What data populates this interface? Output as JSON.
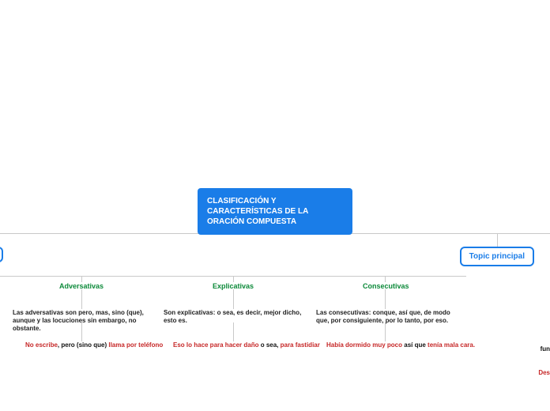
{
  "root": {
    "title": "CLASIFICACIÓN Y CARACTERÍSTICAS DE LA ORACIÓN COMPUESTA"
  },
  "topic_button": "Topic principal",
  "columns": {
    "adversativas": {
      "title": "Adversativas",
      "desc": "Las adversativas son pero, mas, sino (que), aunque y las locuciones sin embargo, no obstante.",
      "example": {
        "p1": "No escribe",
        "p2": ", pero (sino que) ",
        "p3": "llama por teléfono"
      }
    },
    "explicativas": {
      "title": "Explicativas",
      "desc": "Son explicativas: o sea, es decir, mejor dicho, esto es.",
      "example": {
        "p1": "Eso lo hace para hacer daño",
        "p2": " o sea, ",
        "p3": "para fastidiar"
      }
    },
    "consecutivas": {
      "title": "Consecutivas",
      "desc": "Las consecutivas: conque, así que, de modo que, por consiguiente, por lo tanto, por eso.",
      "example": {
        "p1": "Había dormido muy poco",
        "p2": " así que ",
        "p3": "tenía mala cara."
      }
    }
  },
  "right_edge": {
    "line1": "fun",
    "line2": "Des"
  }
}
